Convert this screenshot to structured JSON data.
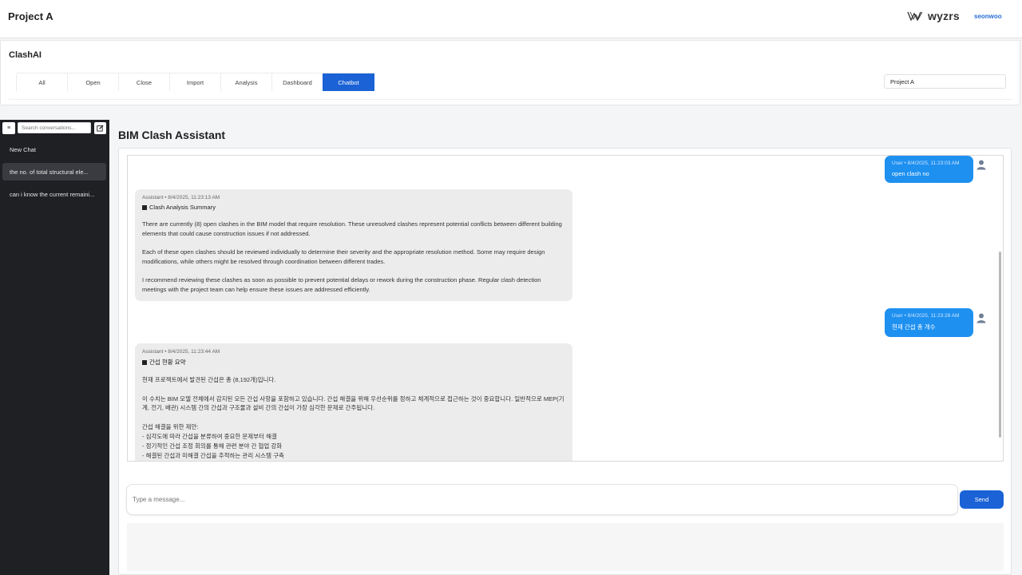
{
  "header": {
    "project_title": "Project A",
    "logo_text": "wyzrs",
    "user_name": "seonwoo"
  },
  "module": {
    "title": "ClashAI",
    "tabs": [
      {
        "label": "All",
        "active": false
      },
      {
        "label": "Open",
        "active": false
      },
      {
        "label": "Close",
        "active": false
      },
      {
        "label": "Import",
        "active": false
      },
      {
        "label": "Analysis",
        "active": false
      },
      {
        "label": "Dashboard",
        "active": false
      },
      {
        "label": "Chatbot",
        "active": true
      }
    ],
    "project_select_value": "Project A"
  },
  "sidebar": {
    "toggle_label": "≡",
    "search_placeholder": "Search conversations...",
    "items": [
      {
        "label": "New Chat"
      },
      {
        "label": "the no. of total structural ele..."
      },
      {
        "label": "can i know the current remaini..."
      }
    ]
  },
  "main": {
    "title": "BIM Clash Assistant",
    "messages": [
      {
        "role": "user",
        "meta": "User • 8/4/2025, 11:23:03 AM",
        "text": "open clash no"
      },
      {
        "role": "assistant",
        "meta": "Assistant • 8/4/2025, 11:23:13 AM",
        "heading": "Clash Analysis Summary",
        "paragraphs": [
          "There are currently (8) open clashes in the BIM model that require resolution. These unresolved clashes represent potential conflicts between different building elements that could cause construction issues if not addressed.",
          "Each of these open clashes should be reviewed individually to determine their severity and the appropriate resolution method. Some may require design modifications, while others might be resolved through coordination between different trades.",
          "I recommend reviewing these clashes as soon as possible to prevent potential delays or rework during the construction phase. Regular clash detection meetings with the project team can help ensure these issues are addressed efficiently."
        ]
      },
      {
        "role": "user",
        "meta": "User • 8/4/2025, 11:23:28 AM",
        "text": "현재 간섭 총 개수"
      },
      {
        "role": "assistant",
        "meta": "Assistant • 8/4/2025, 11:23:44 AM",
        "heading": "간섭 현황 요약",
        "paragraphs": [
          "현재 프로젝트에서 발견된 간섭은 총 (8,192개)입니다.",
          "이 수치는 BIM 모델 전체에서 감지된 모든 간섭 사항을 포함하고 있습니다. 간섭 해결을 위해 우선순위를 정하고 체계적으로 접근하는 것이 중요합니다. 일반적으로 MEP(기계, 전기, 배관) 시스템 간의 간섭과 구조물과 설비 간의 간섭이 가장 심각한 문제로 간주됩니다."
        ],
        "list_title": "간섭 해결을 위한 제안:",
        "list_items": [
          "- 심각도에 따라 간섭을 분류하여 중요한 문제부터 해결",
          "- 정기적인 간섭 조정 회의를 통해 관련 분야 간 협업 강화",
          "- 해결된 간섭과 미해결 간섭을 추적하는 관리 시스템 구축"
        ]
      }
    ],
    "input_placeholder": "Type a message...",
    "send_label": "Send"
  }
}
